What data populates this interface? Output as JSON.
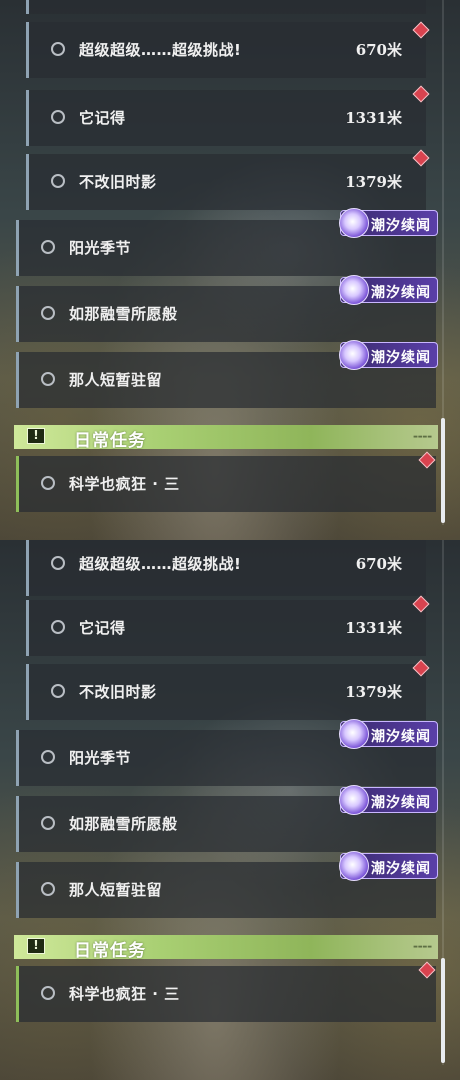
{
  "panels": [
    {
      "quests": [
        {
          "label": "超级超级……超级挑战!",
          "distance": "670米"
        },
        {
          "label": "它记得",
          "distance": "1331米"
        },
        {
          "label": "不改旧时影",
          "distance": "1379米"
        },
        {
          "label": "阳光季节",
          "badge": "潮汐续闻"
        },
        {
          "label": "如那融雪所愿般",
          "badge": "潮汐续闻"
        },
        {
          "label": "那人短暂驻留",
          "badge": "潮汐续闻"
        }
      ],
      "section": {
        "title": "日常任务"
      },
      "daily": {
        "label": "科学也疯狂 · 三"
      }
    },
    {
      "quests": [
        {
          "label": "超级超级……超级挑战!",
          "distance": "670米"
        },
        {
          "label": "它记得",
          "distance": "1331米"
        },
        {
          "label": "不改旧时影",
          "distance": "1379米"
        },
        {
          "label": "阳光季节",
          "badge": "潮汐续闻"
        },
        {
          "label": "如那融雪所愿般",
          "badge": "潮汐续闻"
        },
        {
          "label": "那人短暂驻留",
          "badge": "潮汐续闻"
        }
      ],
      "section": {
        "title": "日常任务"
      },
      "daily": {
        "label": "科学也疯狂 · 三"
      }
    }
  ],
  "colors": {
    "tracked_marker": "#d9434f",
    "badge_bg": "#5a3fa8",
    "daily_header": "#a8cf72",
    "quest_bar": "#8fa3b3"
  },
  "icons": {
    "quest_status": "circle-outline-icon",
    "tracked": "diamond-marker-icon",
    "badge": "tidal-wave-icon",
    "section": "exclamation-box-icon"
  }
}
